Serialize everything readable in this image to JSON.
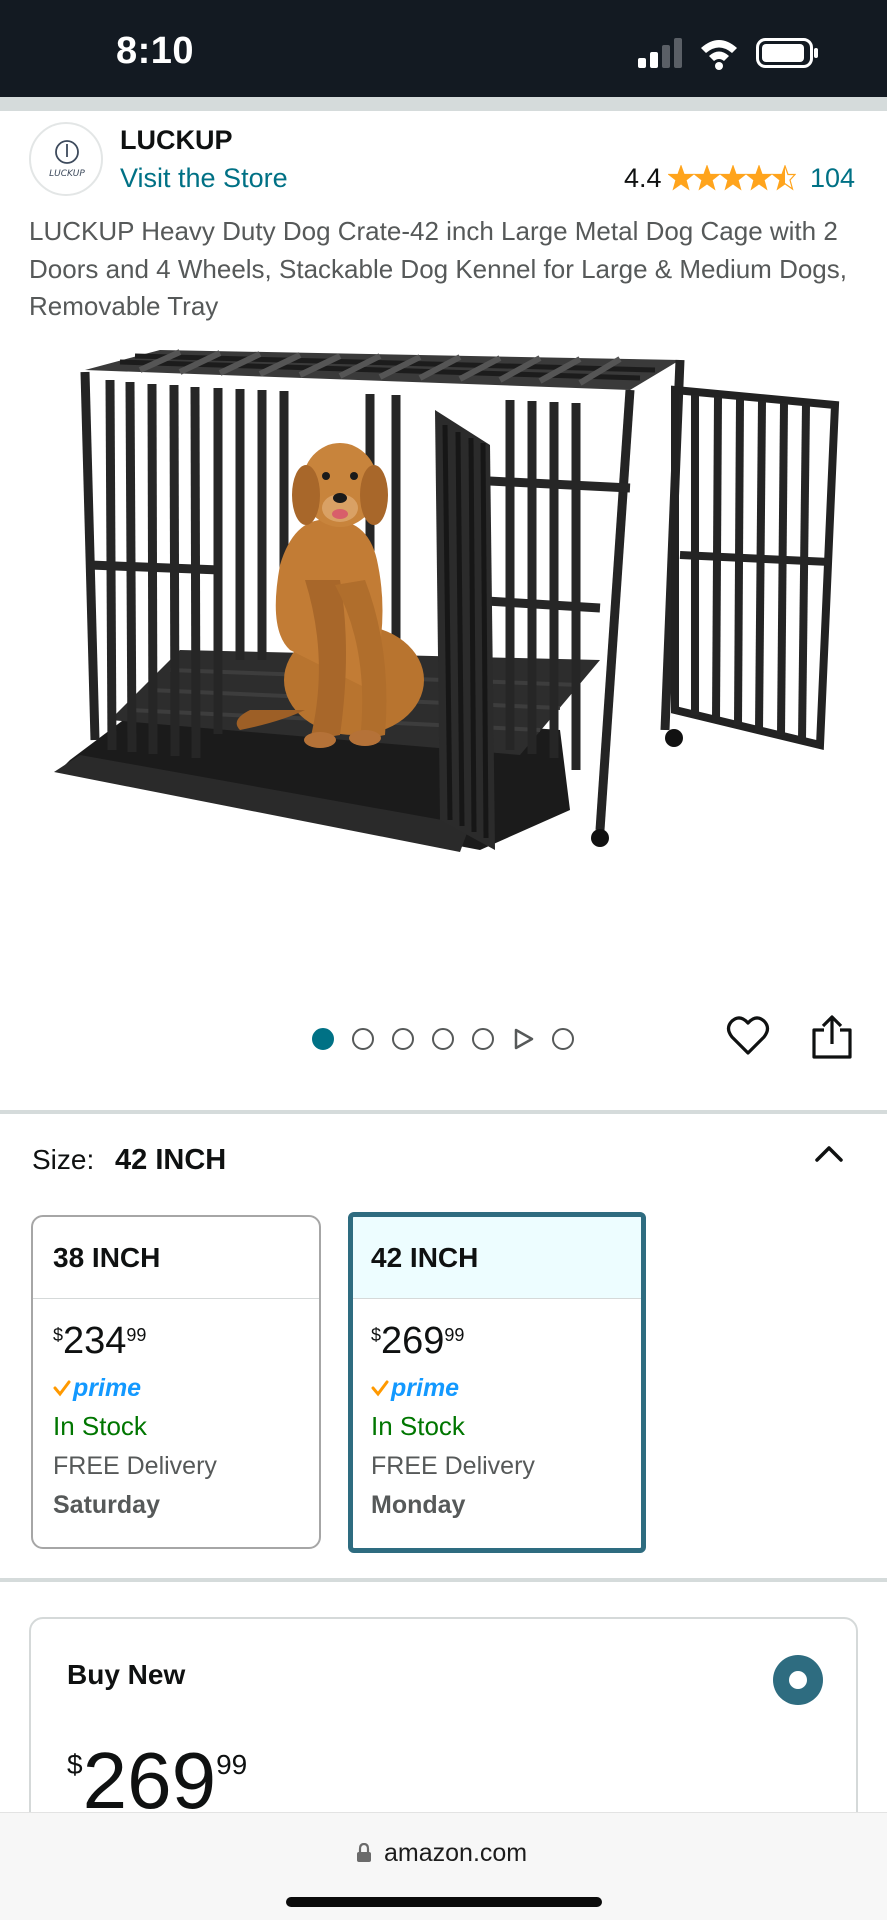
{
  "status_bar": {
    "time": "8:10"
  },
  "brand": {
    "logo_text": "LUCKUP",
    "name": "LUCKUP",
    "visit_store": "Visit the Store",
    "rating": "4.4",
    "stars_value": 4.4,
    "review_count": "104",
    "star_color": "#ffa41c"
  },
  "product": {
    "title": "LUCKUP Heavy Duty Dog Crate-42 inch Large Metal Dog Cage with 2 Doors and 4 Wheels, Stackable Dog Kennel for Large & Medium Dogs, Removable Tray",
    "image_icon": "dog-crate-product-image"
  },
  "carousel": {
    "image_count": 7,
    "active_index": 0,
    "video_index": 5
  },
  "size_selector": {
    "label": "Size:",
    "selected": "42 INCH",
    "options": [
      {
        "size": "38 INCH",
        "price_symbol": "$",
        "price_whole": "234",
        "price_fraction": "99",
        "prime": "prime",
        "stock": "In Stock",
        "delivery": "FREE Delivery",
        "delivery_day": "Saturday",
        "selected": false
      },
      {
        "size": "42 INCH",
        "price_symbol": "$",
        "price_whole": "269",
        "price_fraction": "99",
        "prime": "prime",
        "stock": "In Stock",
        "delivery": "FREE Delivery",
        "delivery_day": "Monday",
        "selected": true
      }
    ]
  },
  "buy_box": {
    "title": "Buy New",
    "price_symbol": "$",
    "price_whole": "269",
    "price_fraction": "99"
  },
  "browser": {
    "url": "amazon.com"
  },
  "colors": {
    "header_bg": "#131a22",
    "link": "#007185",
    "selected_border": "#2e6c80",
    "in_stock": "#007600",
    "prime_blue": "#1399ff",
    "prime_check": "#ff9900"
  }
}
